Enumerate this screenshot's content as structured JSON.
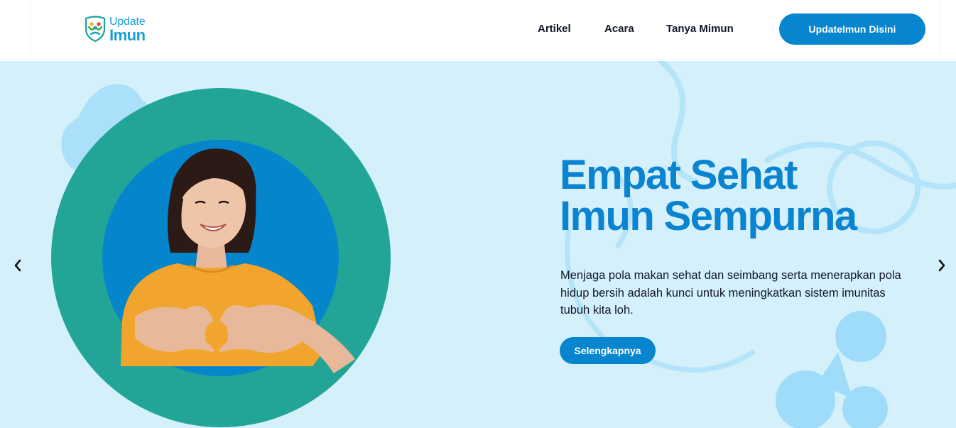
{
  "brand": {
    "line1": "Update",
    "line2": "Imun"
  },
  "nav": {
    "items": [
      "Artikel",
      "Acara",
      "Tanya Mimun"
    ],
    "cta_label": "UpdateImun Disini"
  },
  "hero": {
    "title_line1": "Empat Sehat",
    "title_line2": "Imun Sempurna",
    "description": "Menjaga pola makan sehat dan seimbang serta menerapkan pola hidup bersih adalah kunci untuk meningkatkan sistem imunitas tubuh kita loh.",
    "button_label": "Selengkapnya"
  },
  "icons": {
    "prev": "chevron-left-icon",
    "next": "chevron-right-icon",
    "logo": "shield-family-icon"
  },
  "colors": {
    "primary": "#0785cf",
    "title": "#0a83d1",
    "ring": "#22a597",
    "inner_circle": "#0585cc",
    "hero_bg": "#d4f0fb",
    "shirt": "#f2a52d"
  }
}
